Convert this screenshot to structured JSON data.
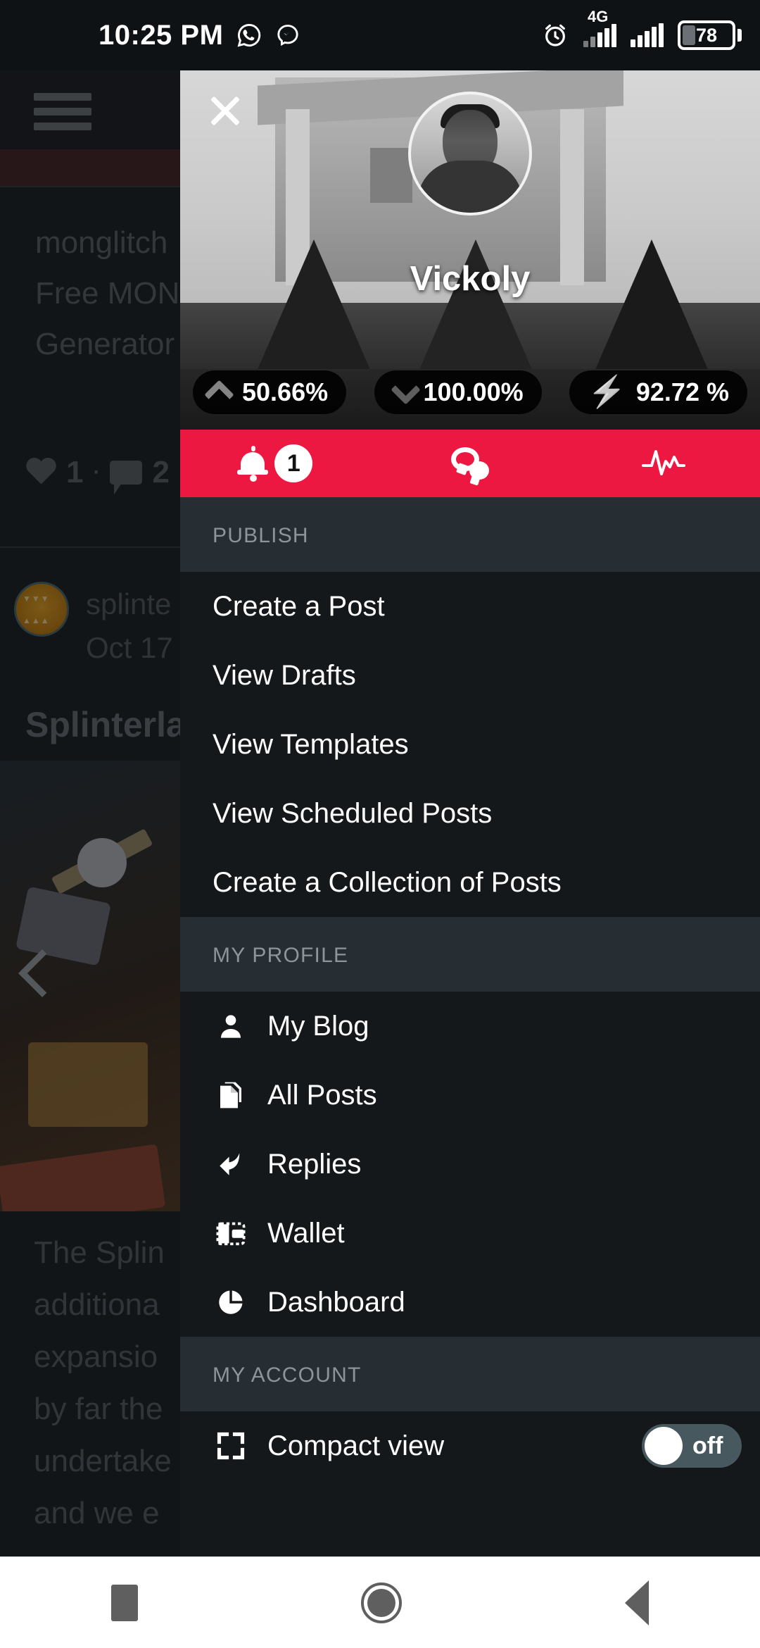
{
  "status_bar": {
    "time": "10:25 PM",
    "icons": [
      "whatsapp-icon",
      "messenger-icon",
      "alarm-icon",
      "signal-4g-icon",
      "signal-icon"
    ],
    "network_label": "4G",
    "battery_percent": "78"
  },
  "background_app": {
    "menu_icon": "hamburger-icon",
    "post1": {
      "title_lines": [
        "monglitch",
        "Free MON",
        "Generator"
      ],
      "likes": "1",
      "separator": "·",
      "comments": "2"
    },
    "post2": {
      "author": "splinte",
      "date": "Oct 17",
      "title": "Splinterla",
      "carousel_prev": "chevron-left-icon",
      "body_lines": [
        "The Splin",
        "additiona",
        "expansio",
        "by far the",
        "undertake",
        "and we e"
      ]
    }
  },
  "drawer": {
    "close_label": "close-icon",
    "profile": {
      "username": "Vickoly",
      "stats": [
        {
          "icon": "chevron-up-icon",
          "value": "50.66%",
          "color": "#2b95e8"
        },
        {
          "icon": "chevron-down-icon",
          "value": "100.00%",
          "color": "#f0363b"
        },
        {
          "icon": "lightning-bolt-icon",
          "value": "92.72 %",
          "color": "#3ece54"
        }
      ]
    },
    "action_bar": {
      "background": "#ed1842",
      "items": [
        {
          "icon": "bell-icon",
          "badge": "1"
        },
        {
          "icon": "chat-bubbles-icon",
          "badge": ""
        },
        {
          "icon": "activity-pulse-icon",
          "badge": ""
        }
      ]
    },
    "sections": [
      {
        "header": "PUBLISH",
        "items": [
          {
            "label": "Create a Post",
            "icon": ""
          },
          {
            "label": "View Drafts",
            "icon": ""
          },
          {
            "label": "View Templates",
            "icon": ""
          },
          {
            "label": "View Scheduled Posts",
            "icon": ""
          },
          {
            "label": "Create a Collection of Posts",
            "icon": ""
          }
        ]
      },
      {
        "header": "MY PROFILE",
        "items": [
          {
            "label": "My Blog",
            "icon": "person-icon"
          },
          {
            "label": "All Posts",
            "icon": "document-icon"
          },
          {
            "label": "Replies",
            "icon": "reply-arrow-icon"
          },
          {
            "label": "Wallet",
            "icon": "wallet-icon"
          },
          {
            "label": "Dashboard",
            "icon": "pie-chart-icon"
          }
        ]
      },
      {
        "header": "MY ACCOUNT",
        "items": [
          {
            "label": "Compact view",
            "icon": "fullscreen-icon",
            "toggle": "off"
          }
        ]
      }
    ]
  },
  "nav_bar": {
    "buttons": [
      "recents-square-icon",
      "home-circle-icon",
      "back-triangle-icon"
    ]
  }
}
